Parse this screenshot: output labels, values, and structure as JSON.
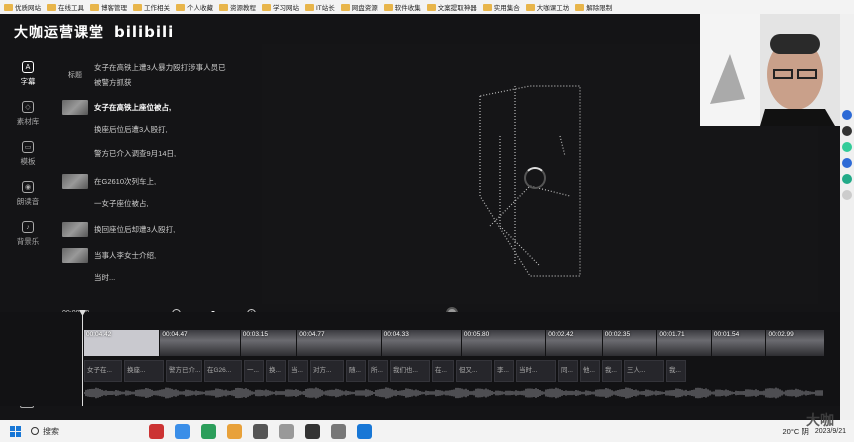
{
  "bookmarks": [
    "优质网站",
    "在线工具",
    "博客管理",
    "工作相关",
    "个人收藏",
    "资源教程",
    "学习网站",
    "IT站长",
    "网盘资源",
    "软件收集",
    "文案提取神器",
    "实用集合",
    "大咖课工坊",
    "解除限制"
  ],
  "brand": {
    "title": "大咖运营课堂",
    "logo": "bilibili"
  },
  "sidebar": [
    {
      "label": "字幕",
      "icon": "subtitle-icon",
      "active": true
    },
    {
      "label": "素材库",
      "icon": "cube-icon",
      "active": false
    },
    {
      "label": "模板",
      "icon": "template-icon",
      "active": false
    },
    {
      "label": "朗读音",
      "icon": "voice-icon",
      "active": false
    },
    {
      "label": "背景乐",
      "icon": "music-icon",
      "active": false
    }
  ],
  "script_list": [
    {
      "kind": "tag",
      "tag": "标题",
      "text": "女子在高铁上遭3人暴力殴打涉事人员已",
      "text2": "被警方抓获"
    },
    {
      "kind": "thumb",
      "text": "女子在高铁上座位被占,",
      "bold": true
    },
    {
      "kind": "none",
      "text": "换座后位后遭3人殴打,"
    },
    {
      "kind": "none",
      "text": "警方已介入调查9月14日,"
    },
    {
      "kind": "thumb",
      "text": "在G2610次列车上,"
    },
    {
      "kind": "none",
      "text": "一女子座位被占,"
    },
    {
      "kind": "thumb",
      "text": "换回座位后却遭3人殴打,"
    },
    {
      "kind": "thumb",
      "text": "当事人李女士介绍,"
    },
    {
      "kind": "none",
      "text": "当时..."
    }
  ],
  "controls": {
    "timecode": "00:00:00"
  },
  "timeline": {
    "clips": [
      "00:04.42",
      "00:04.47",
      "00:03.15",
      "00:04.77",
      "00:04.33",
      "00:05.80",
      "00:02.42",
      "00:02.35",
      "00:01.71",
      "00:01.54",
      "00:02.99"
    ],
    "subtitles": [
      "女子在...",
      "换座...",
      "警方已介...",
      "在G26...",
      "一...",
      "换...",
      "当...",
      "对方...",
      "随...",
      "所...",
      "我们也...",
      "在...",
      "但又...",
      "李...",
      "当时...",
      "同...",
      "他...",
      "我...",
      "三人...",
      "我..."
    ]
  },
  "taskbar": {
    "search_placeholder": "搜索",
    "weather": "20°C 阴",
    "time": "",
    "date": "2023/9/21"
  },
  "watermark": "大咖",
  "colors": {
    "accent": "#1877d6",
    "folder": "#e8b54a"
  }
}
